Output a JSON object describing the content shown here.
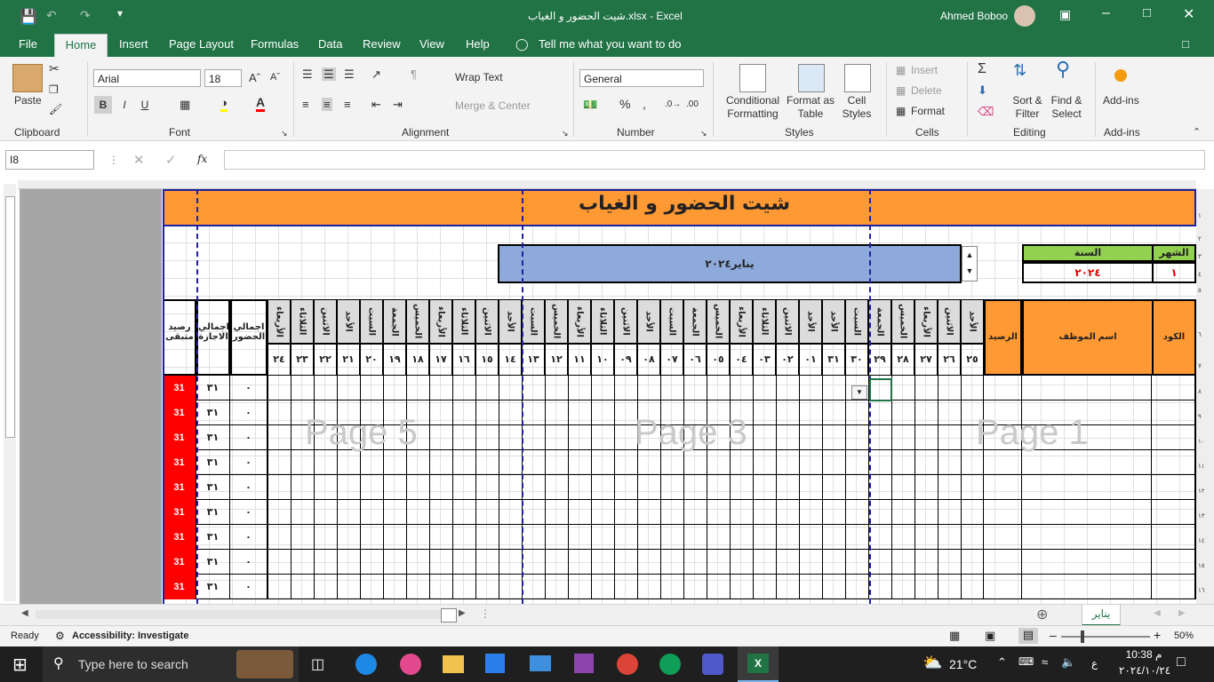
{
  "window": {
    "title": "شيت الحضور و الغياب.xlsx  -  Excel",
    "user_name": "Ahmed Boboo"
  },
  "ribbon_tabs": [
    "File",
    "Home",
    "Insert",
    "Page Layout",
    "Formulas",
    "Data",
    "Review",
    "View",
    "Help"
  ],
  "tell_me": "Tell me what you want to do",
  "clipboard": {
    "paste": "Paste",
    "group": "Clipboard"
  },
  "font": {
    "name": "Arial",
    "size": "18",
    "group": "Font",
    "bold": "B",
    "italic": "I",
    "underline": "U"
  },
  "alignment": {
    "wrap": "Wrap Text",
    "merge": "Merge & Center",
    "group": "Alignment"
  },
  "number": {
    "format": "General",
    "group": "Number",
    "percent": "%",
    "comma": ","
  },
  "styles": {
    "cond1": "Conditional",
    "cond2": "Formatting",
    "fmt1": "Format as",
    "fmt2": "Table",
    "cell1": "Cell",
    "cell2": "Styles",
    "group": "Styles"
  },
  "cells": {
    "insert": "Insert",
    "delete": "Delete",
    "format": "Format",
    "group": "Cells"
  },
  "editing": {
    "sort1": "Sort &",
    "sort2": "Filter",
    "find1": "Find &",
    "find2": "Select",
    "group": "Editing"
  },
  "addins": {
    "label": "Add-ins",
    "group": "Add-ins"
  },
  "formula_bar": {
    "name_box": "I8",
    "fx": "fx",
    "formula": ""
  },
  "sheet": {
    "title": "شيت الحضور و الغياب",
    "month_header": "الشهر",
    "year_header": "السنة",
    "month_value": "١",
    "year_value": "٢٠٢٤",
    "period_label": "يناير٢٠٢٤",
    "headers": {
      "code": "الكود",
      "employee": "اسم الموظف",
      "balance": "الرصيد",
      "total_presence": "اجمالي الحضور",
      "total_leave": "اجمالي الاجازة",
      "remaining": "رصيد متبقى"
    },
    "days": [
      {
        "d": "الأحد",
        "n": "٢٥"
      },
      {
        "d": "الاثنين",
        "n": "٢٦"
      },
      {
        "d": "الأربعاء",
        "n": "٢٧"
      },
      {
        "d": "الخميس",
        "n": "٢٨"
      },
      {
        "d": "الجمعة",
        "n": "٢٩"
      },
      {
        "d": "السبت",
        "n": "٣٠"
      },
      {
        "d": "الأحد",
        "n": "٣١"
      },
      {
        "d": "الأحد",
        "n": "٠١"
      },
      {
        "d": "الاثنين",
        "n": "٠٢"
      },
      {
        "d": "الثلاثاء",
        "n": "٠٣"
      },
      {
        "d": "الأربعاء",
        "n": "٠٤"
      },
      {
        "d": "الخميس",
        "n": "٠٥"
      },
      {
        "d": "الجمعة",
        "n": "٠٦"
      },
      {
        "d": "السبت",
        "n": "٠٧"
      },
      {
        "d": "الأحد",
        "n": "٠٨"
      },
      {
        "d": "الاثنين",
        "n": "٠٩"
      },
      {
        "d": "الثلاثاء",
        "n": "١٠"
      },
      {
        "d": "الأربعاء",
        "n": "١١"
      },
      {
        "d": "الخميس",
        "n": "١٢"
      },
      {
        "d": "السبت",
        "n": "١٣"
      },
      {
        "d": "الأحد",
        "n": "١٤"
      },
      {
        "d": "الاثنين",
        "n": "١٥"
      },
      {
        "d": "الثلاثاء",
        "n": "١٦"
      },
      {
        "d": "الأربعاء",
        "n": "١٧"
      },
      {
        "d": "الخميس",
        "n": "١٨"
      },
      {
        "d": "الجمعة",
        "n": "١٩"
      },
      {
        "d": "السبت",
        "n": "٢٠"
      },
      {
        "d": "الأحد",
        "n": "٢١"
      },
      {
        "d": "الاثنين",
        "n": "٢٢"
      },
      {
        "d": "الثلاثاء",
        "n": "٢٣"
      },
      {
        "d": "الأربعاء",
        "n": "٢٤"
      }
    ],
    "rows": [
      {
        "presence": "٠",
        "leave": "٣١",
        "remaining": "31"
      },
      {
        "presence": "٠",
        "leave": "٣١",
        "remaining": "31"
      },
      {
        "presence": "٠",
        "leave": "٣١",
        "remaining": "31"
      },
      {
        "presence": "٠",
        "leave": "٣١",
        "remaining": "31"
      },
      {
        "presence": "٠",
        "leave": "٣١",
        "remaining": "31"
      },
      {
        "presence": "٠",
        "leave": "٣١",
        "remaining": "31"
      },
      {
        "presence": "٠",
        "leave": "٣١",
        "remaining": "31"
      },
      {
        "presence": "٠",
        "leave": "٣١",
        "remaining": "31"
      },
      {
        "presence": "٠",
        "leave": "٣١",
        "remaining": "31"
      }
    ],
    "row_numbers": [
      "١",
      "٢",
      "٣",
      "٤",
      "٥",
      "٦",
      "٧",
      "٨",
      "٩",
      "١٠",
      "١١",
      "١٢",
      "١٣",
      "١٤",
      "١٥",
      "١٦"
    ],
    "page_watermarks": [
      "Page 5",
      "Page 3",
      "Page 1"
    ],
    "colors": {
      "orange": "#ff9933",
      "green": "#92d050",
      "blue": "#8eaadb",
      "red": "#ff0000",
      "navy": "#1f1f9f"
    }
  },
  "sheet_tab": "يناير",
  "status": {
    "ready": "Ready",
    "accessibility": "Accessibility: Investigate",
    "zoom": "50%"
  },
  "taskbar": {
    "search": "Type here to search",
    "weather": "21°C",
    "time": "م 10:38",
    "date": "٢٠٢٤/١٠/٢٤",
    "lang": "ع"
  }
}
